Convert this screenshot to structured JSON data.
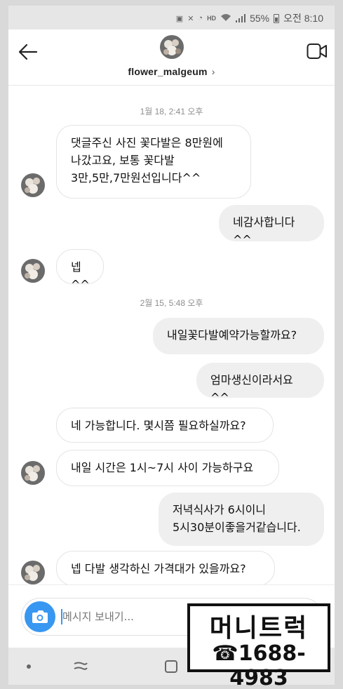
{
  "status_bar": {
    "hd_label": "HD",
    "battery": "55%",
    "time": "오전 8:10"
  },
  "header": {
    "username": "flower_malgeum",
    "username_chevron": "›",
    "back_icon": "arrow-left-icon",
    "video_icon": "video-camera-icon"
  },
  "messages": [
    {
      "type": "timestamp",
      "text": "1월 18, 2:41 오후"
    },
    {
      "type": "received",
      "text": "댓글주신 사진 꽃다발은 8만원에\n나갔고요, 보통 꽃다발\n3만,5만,7만원선입니다^^"
    },
    {
      "type": "sent",
      "text": "네감사합니다^^"
    },
    {
      "type": "received",
      "text": "넵^^"
    },
    {
      "type": "timestamp",
      "text": "2월 15, 5:48 오후"
    },
    {
      "type": "sent",
      "text": "내일꽃다발예약가능할까요?"
    },
    {
      "type": "sent",
      "text": "엄마생신이라서요^^"
    },
    {
      "type": "received",
      "text": "네 가능합니다. 몇시쯤 필요하실까요?"
    },
    {
      "type": "received",
      "text": "내일 시간은 1시~7시 사이 가능하구요"
    },
    {
      "type": "sent",
      "text": "저녁식사가 6시이니\n5시30분이좋을거같습니다."
    },
    {
      "type": "received",
      "text": "넵 다발 생각하신 가격대가 있을까요?"
    }
  ],
  "composer": {
    "placeholder": "메시지 보내기...",
    "camera_icon": "camera-icon",
    "mic_icon": "microphone-icon",
    "gallery_icon": "gallery-icon",
    "sticker_icon": "sticker-icon"
  },
  "watermark": {
    "title": "머니트럭",
    "phone": "☎1688-4983"
  },
  "colors": {
    "accent": "#3897f0",
    "sent_bubble": "#efefef",
    "received_border": "#e4e4e4"
  }
}
